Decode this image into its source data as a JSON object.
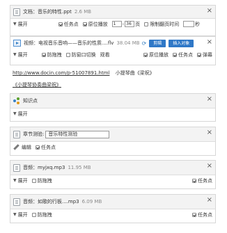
{
  "panel1": {
    "title": "文档：音乐的特性.ppt",
    "size": "2.6 MB",
    "expand": "展开",
    "task_point": "任务点",
    "original_play": "原位播放",
    "page_from": "1",
    "page_to": "36",
    "page_unit": "页",
    "limit_view": "限制翻页时间",
    "seconds": "秒"
  },
  "panel2": {
    "title": "视频：电视音乐音响——音乐的性质....flv",
    "size": "38.04 MB",
    "edit_btn": "剪辑",
    "insert_btn": "插入对象",
    "expand": "展开",
    "anti_drag": "防拖拽",
    "anti_switch": "防窗口切换",
    "watch": "观看",
    "original_play": "原位播放",
    "task_point": "任务点",
    "danmu": "弹幕"
  },
  "links": {
    "url": "http://www.docin.com/p-51007891.html",
    "url_label": "小提琴曲《梁祝》",
    "line2": "《小提琴协奏曲梁祝》"
  },
  "panel3": {
    "title": "知识点",
    "expand": "展开"
  },
  "panel4": {
    "title": "章节测验:",
    "input_value": "音乐特性测验",
    "edit": "编辑",
    "task_point": "任务点"
  },
  "panel5": {
    "title": "音频：myjxq.mp3",
    "size": "11.95 MB",
    "expand": "展开",
    "anti_drag": "防拖拽",
    "task_point": "任务点"
  },
  "panel6": {
    "title": "音频：如歌的行板....mp3",
    "size": "6.09 MB",
    "expand": "展开",
    "anti_drag": "防拖拽",
    "task_point": "任务点"
  },
  "icons": {
    "close": "×",
    "expand_arrow": "▼"
  },
  "colors": {
    "accent_blue": "#2f78c7",
    "header_bg": "#f3f3f3",
    "border": "#d7d7d7"
  }
}
